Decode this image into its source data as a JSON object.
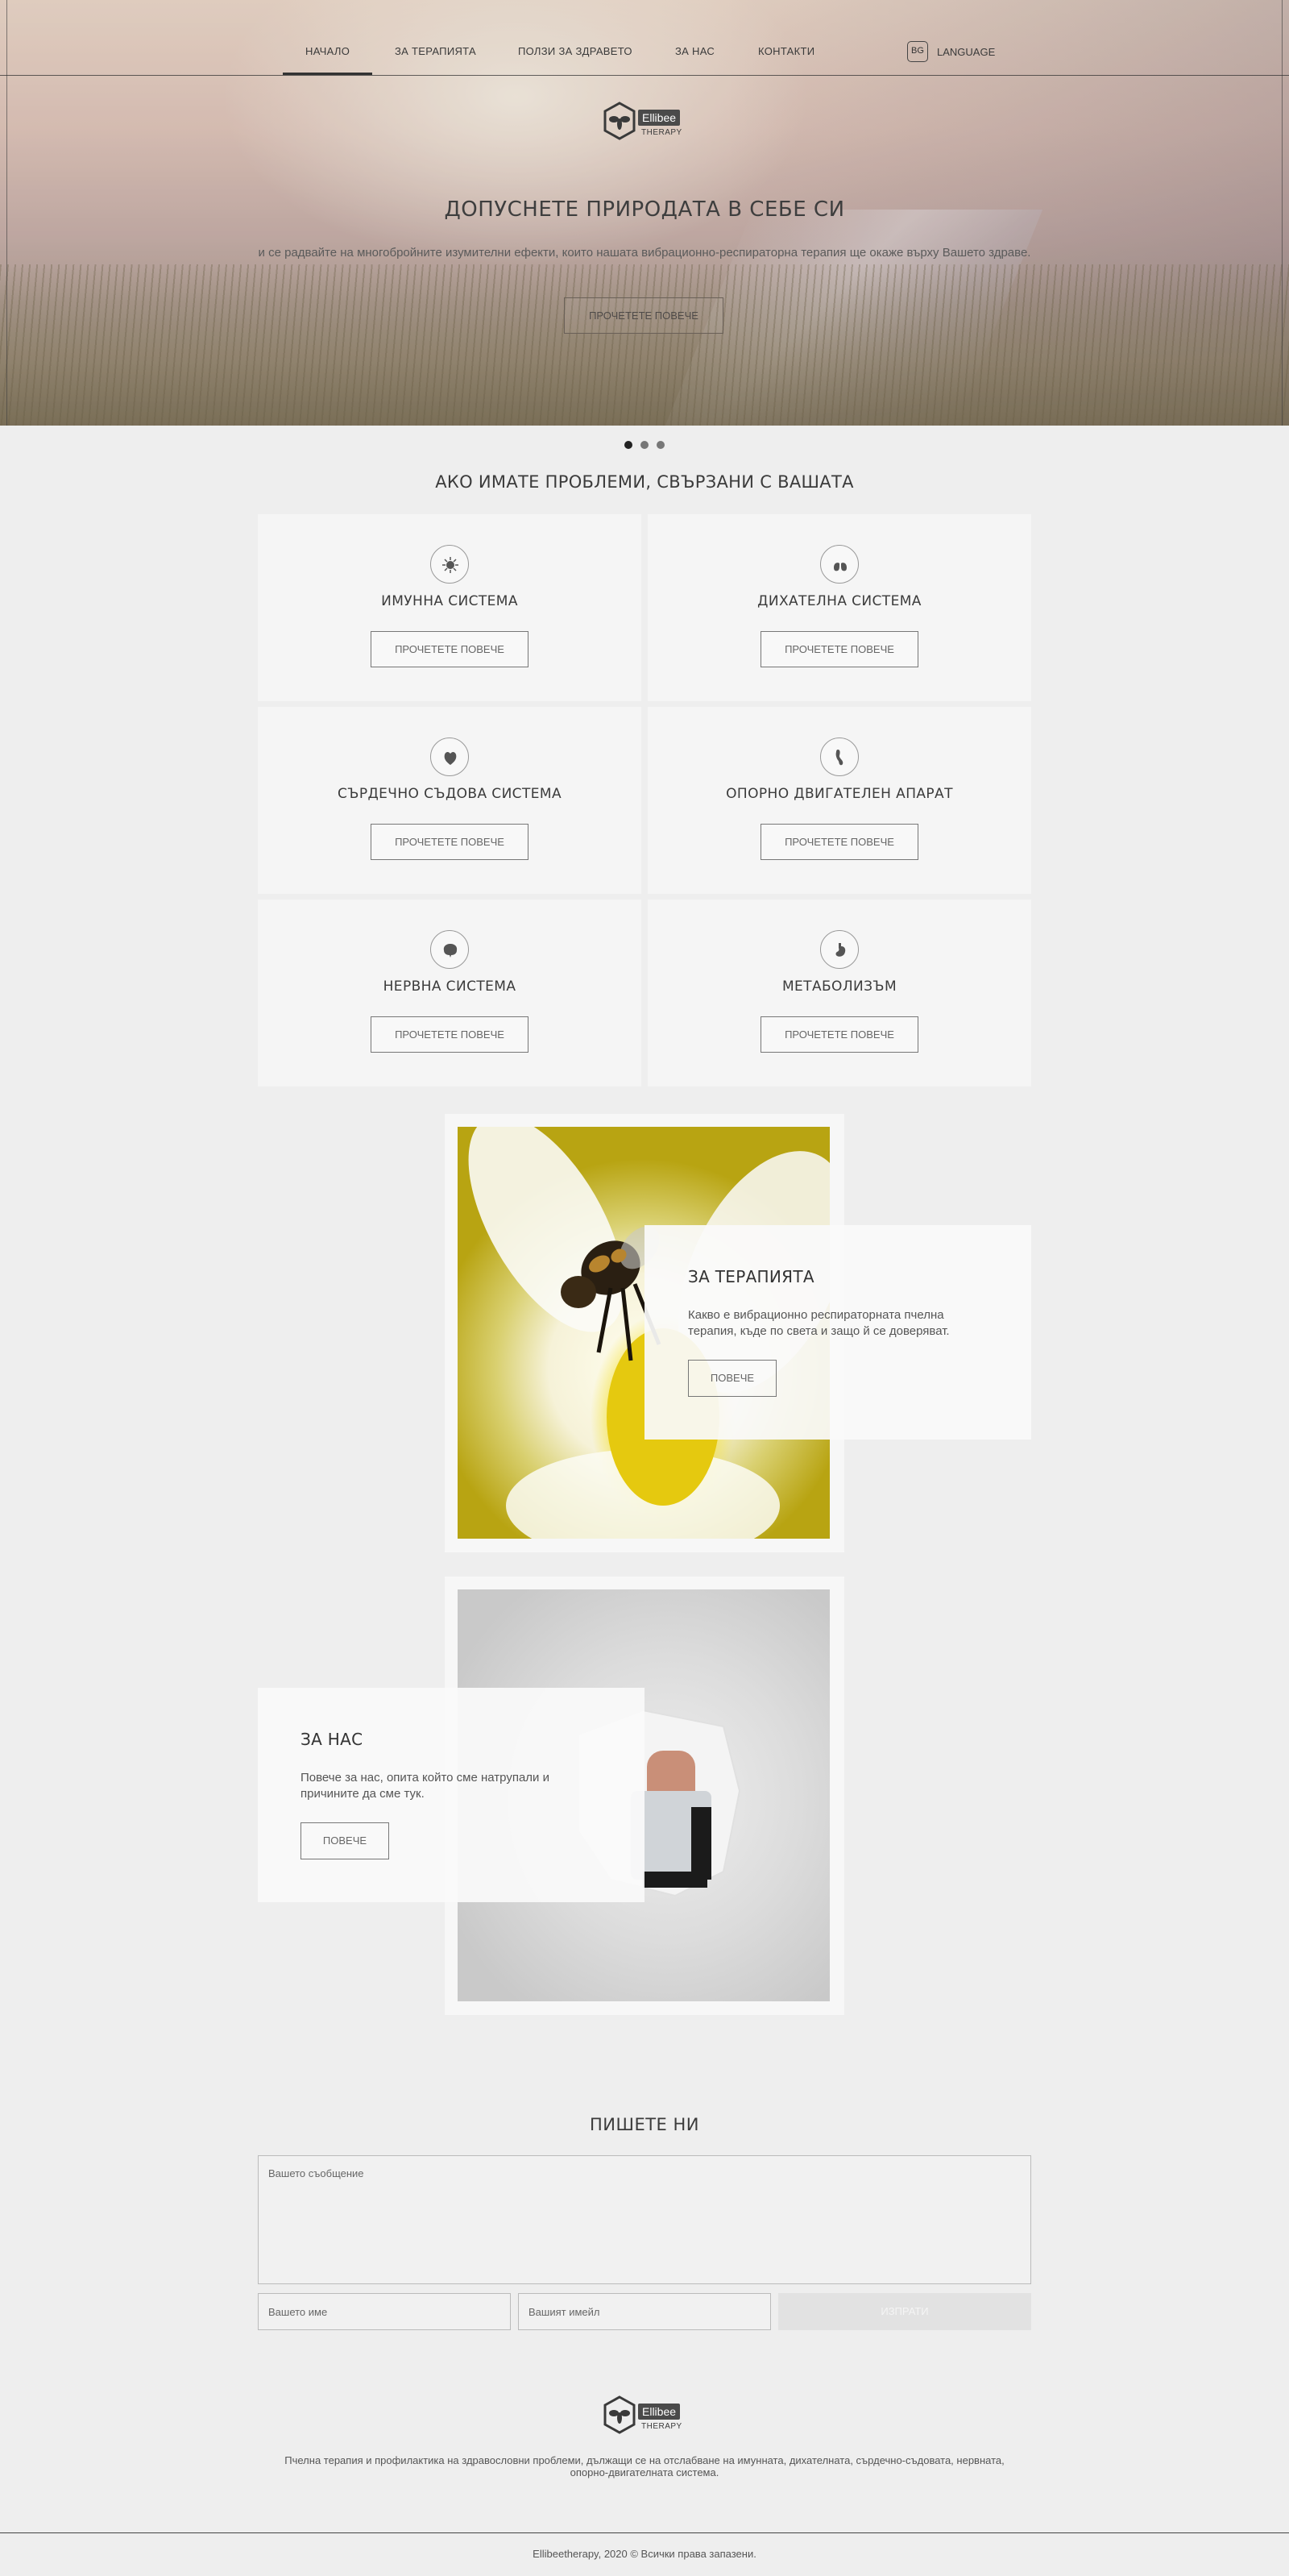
{
  "nav": {
    "items": [
      {
        "label": "НАЧАЛО",
        "active": true
      },
      {
        "label": "ЗА ТЕРАПИЯТА"
      },
      {
        "label": "ПОЛЗИ ЗА ЗДРАВЕТО"
      },
      {
        "label": "ЗА НАС"
      },
      {
        "label": "КОНТАКТИ"
      }
    ],
    "lang_badge": "BG",
    "lang_label": "LANGUAGE"
  },
  "logo": {
    "word": "Ellibee",
    "sub": "THERAPY"
  },
  "hero": {
    "title": "ДОПУСНЕТЕ ПРИРОДАТА В СЕБЕ СИ",
    "subtitle": "и се радвайте на многобройните изумителни ефекти, които нашата вибрационно-респираторна терапия ще окаже върху Вашето здраве.",
    "button": "ПРОЧЕТЕТЕ ПОВЕЧЕ"
  },
  "slider": {
    "count": 3,
    "active": 0
  },
  "problems": {
    "title": "АКО ИМАТЕ ПРОБЛЕМИ, СВЪРЗАНИ С ВАШАТА",
    "cards": [
      {
        "title": "ИМУННА СИСТЕМА",
        "icon": "virus-icon",
        "button": "ПРОЧЕТЕТЕ ПОВЕЧЕ"
      },
      {
        "title": "ДИХАТЕЛНА СИСТЕМА",
        "icon": "lungs-icon",
        "button": "ПРОЧЕТЕТЕ ПОВЕЧЕ"
      },
      {
        "title": "СЪРДЕЧНО СЪДОВА СИСТЕМА",
        "icon": "heart-icon",
        "button": "ПРОЧЕТЕТЕ ПОВЕЧЕ"
      },
      {
        "title": "ОПОРНО ДВИГАТЕЛЕН АПАРАТ",
        "icon": "bone-icon",
        "button": "ПРОЧЕТЕТЕ ПОВЕЧЕ"
      },
      {
        "title": "НЕРВНА СИСТЕМА",
        "icon": "brain-icon",
        "button": "ПРОЧЕТЕТЕ ПОВЕЧЕ"
      },
      {
        "title": "МЕТАБОЛИЗЪМ",
        "icon": "stomach-icon",
        "button": "ПРОЧЕТЕТЕ ПОВЕЧЕ"
      }
    ]
  },
  "therapy": {
    "title": "ЗА ТЕРАПИЯТА",
    "text": "Какво е вибрационно респираторната пчелна терапия, къде по света и защо й се доверяват.",
    "button": "ПОВЕЧЕ"
  },
  "about": {
    "title": "ЗА НАС",
    "text": "Повече за нас, опита който сме натрупали и причините да сме тук.",
    "button": "ПОВЕЧЕ"
  },
  "contact": {
    "title": "ПИШЕТЕ НИ",
    "message_placeholder": "Вашето съобщение",
    "name_placeholder": "Вашето име",
    "email_placeholder": "Вашият имейл",
    "send": "ИЗПРАТИ"
  },
  "footer": {
    "description": "Пчелна терапия и профилактика на здравословни проблеми, дължащи се на отслабване на имунната, дихателната, сърдечно-съдовата, нервната, опорно-двигателната система.",
    "copyright": "Ellibeetherapy, 2020 © Всички права запазени."
  }
}
